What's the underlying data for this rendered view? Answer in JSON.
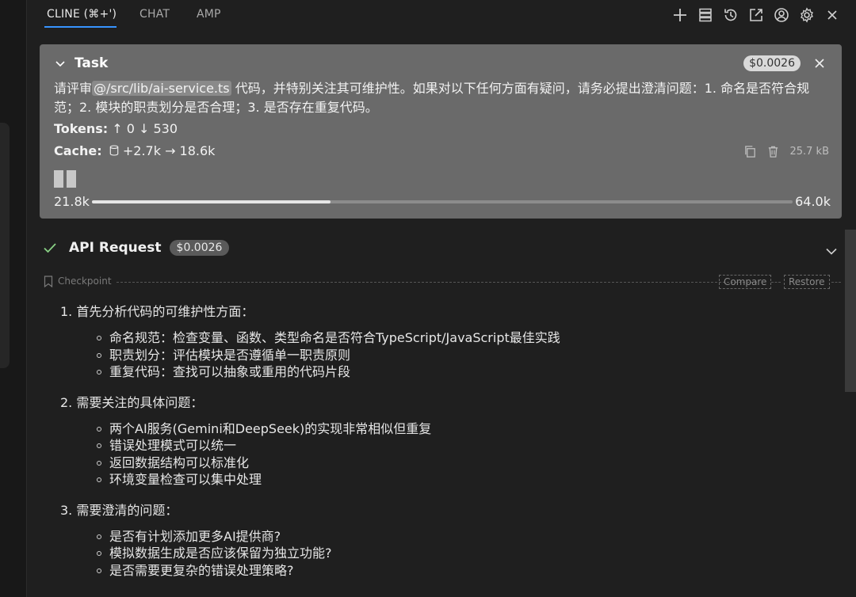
{
  "tabs": [
    {
      "label": "CLINE (⌘+')",
      "active": true
    },
    {
      "label": "CHAT",
      "active": false
    },
    {
      "label": "AMP",
      "active": false
    }
  ],
  "header_icons": [
    "plus-icon",
    "server-icon",
    "history-icon",
    "open-external-icon",
    "account-icon",
    "settings-icon",
    "close-icon"
  ],
  "task": {
    "title": "Task",
    "cost": "$0.0026",
    "text_before": "请评审",
    "mention": "@/src/lib/ai-service.ts",
    "text_after": " 代码，并特别关注其可维护性。如果对以下任何方面有疑问，请务必提出澄清问题：1. 命名是否符合规范；2. 模块的职责划分是否合理；3. 是否存在重复代码。",
    "tokens_label": "Tokens:",
    "tokens_value": "↑ 0 ↓ 530",
    "cache_label": "Cache:",
    "cache_value": "+2.7k → 18.6k",
    "size": "25.7 kB",
    "context_used": "21.8k",
    "context_total": "64.0k",
    "context_fraction": 0.34
  },
  "api_request": {
    "title": "API Request",
    "cost": "$0.0026"
  },
  "checkpoint": {
    "label": "Checkpoint",
    "compare": "Compare",
    "restore": "Restore"
  },
  "sections": [
    {
      "heading": "1. 首先分析代码的可维护性方面：",
      "items": [
        "命名规范：检查变量、函数、类型命名是否符合TypeScript/JavaScript最佳实践",
        "职责划分：评估模块是否遵循单一职责原则",
        "重复代码：查找可以抽象或重用的代码片段"
      ]
    },
    {
      "heading": "2. 需要关注的具体问题：",
      "items": [
        "两个AI服务(Gemini和DeepSeek)的实现非常相似但重复",
        "错误处理模式可以统一",
        "返回数据结构可以标准化",
        "环境变量检查可以集中处理"
      ]
    },
    {
      "heading": "3. 需要澄清的问题：",
      "items": [
        "是否有计划添加更多AI提供商?",
        "模拟数据生成是否应该保留为独立功能?",
        "是否需要更复杂的错误处理策略?"
      ]
    }
  ],
  "colors": {
    "background": "#1f1f1f",
    "task_card": "#6a6a6a",
    "accent": "#3794ff",
    "success": "#89d185"
  }
}
